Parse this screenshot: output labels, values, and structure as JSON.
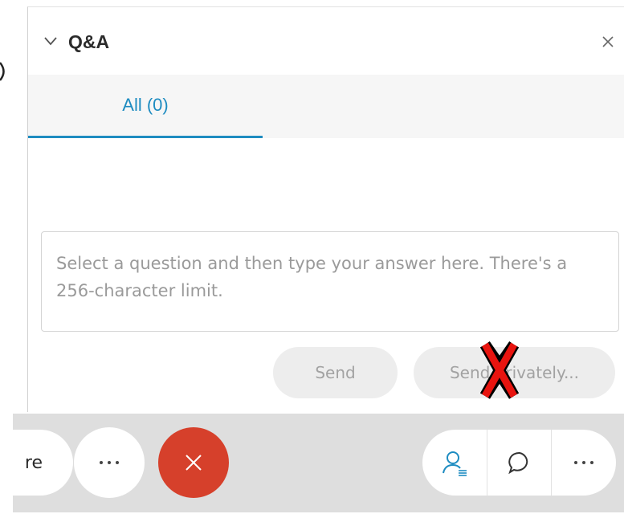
{
  "panel": {
    "title": "Q&A",
    "tabs": [
      {
        "label": "All (0)",
        "active": true
      }
    ],
    "answer_placeholder": "Select a question and then type your answer here. There's a 256-character limit.",
    "send_label": "Send",
    "send_privately_label": "Send privately..."
  },
  "toolbar": {
    "left_pill_label": "re"
  },
  "colors": {
    "accent": "#1e8cc1",
    "end_call": "#d6402b",
    "annotation_x": "#e8140f"
  },
  "icons": [
    "chevron-down-icon",
    "close-icon",
    "more-icon",
    "end-call-icon",
    "participants-icon",
    "chat-icon"
  ]
}
